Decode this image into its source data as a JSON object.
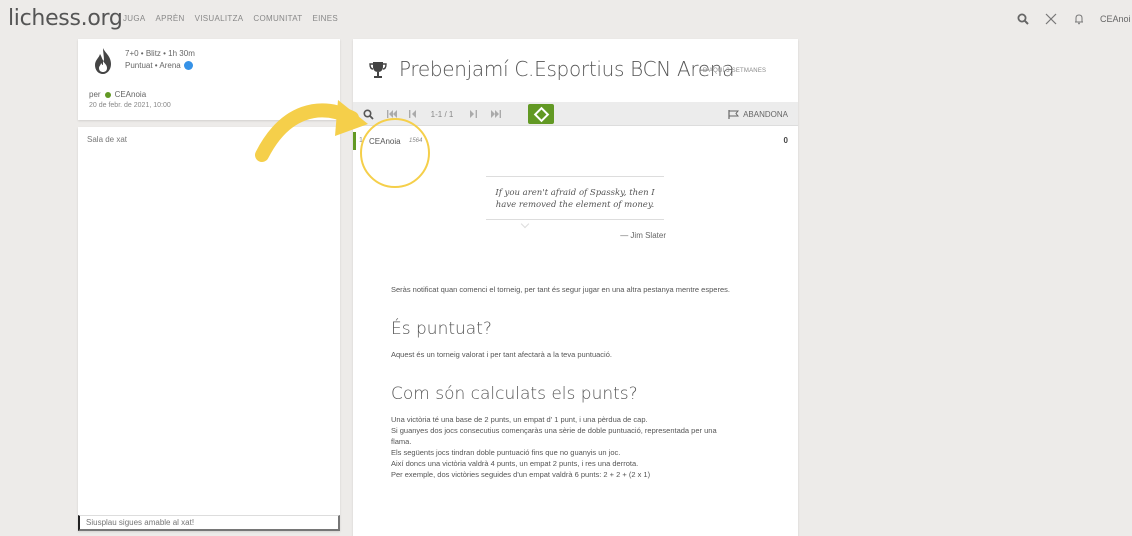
{
  "topbar": {
    "logo": "lichess.org",
    "nav": [
      "JUGA",
      "APRÈN",
      "VISUALITZA",
      "COMUNITAT",
      "EINES"
    ],
    "username": "CEAnoi"
  },
  "info": {
    "line1": "7+0 • Blitz • 1h 30m",
    "line2": "Puntuat • Arena",
    "by_prefix": "per",
    "creator": "CEAnoia",
    "date": "20 de febr. de 2021, 10:00"
  },
  "chat": {
    "title": "Sala de xat",
    "placeholder": "Siusplau sigues amable al xat!"
  },
  "tournament": {
    "title": "Prebenjamí C.Esportius BCN Arena",
    "when": "D'AQUÍ 3 SETMANES"
  },
  "toolbar": {
    "page": "1-1 / 1",
    "abandon": "ABANDONA"
  },
  "standings": [
    {
      "rank": "1",
      "name": "CEAnoia",
      "rating": "1564",
      "score": "0"
    }
  ],
  "quote": {
    "text": "If you aren't afraid of Spassky, then I have removed the element of money.",
    "author": "— Jim Slater"
  },
  "content": {
    "notify": "Seràs notificat quan comenci el torneig, per tant és segur jugar en una altra pestanya mentre esperes.",
    "h_rated": "És puntuat?",
    "rated_text": "Aquest és un torneig valorat i per tant afectarà a la teva puntuació.",
    "h_points": "Com són calculats els punts?",
    "points_lines": [
      "Una victòria té una base de 2 punts, un empat d' 1 punt, i una pèrdua de cap.",
      "Si guanyes dos jocs consecutius començaràs una sèrie de doble puntuació, representada per una flama.",
      "Els següents jocs tindran doble puntuació fins que no guanyis un joc.",
      "Així doncs una victòria valdrà 4 punts, un empat 2 punts, i res una derrota.",
      "Per exemple, dos victòries seguides d'un empat valdrà 6 punts: 2 + 2 + (2 x 1)"
    ]
  },
  "colors": {
    "accent_green": "#629924",
    "annotation_yellow": "#f5cf4a",
    "flame": "#e86a24"
  }
}
